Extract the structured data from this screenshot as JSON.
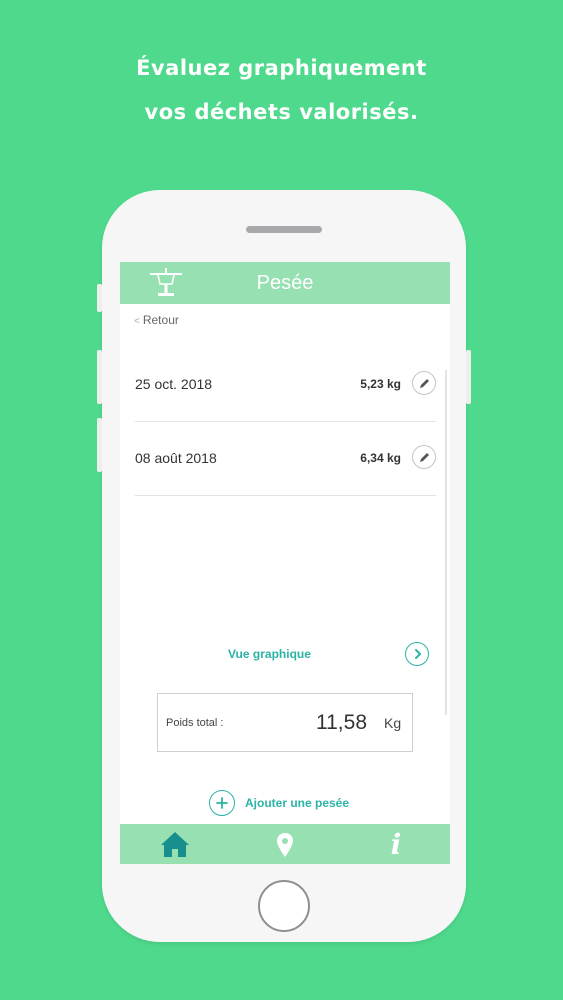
{
  "headline": {
    "line1": "Évaluez graphiquement",
    "line2": "vos déchets valorisés."
  },
  "app": {
    "title": "Pesée",
    "back_label": "Retour",
    "logo_icon": "scale-icon"
  },
  "weighings": [
    {
      "date": "25 oct. 2018",
      "weight": "5,23 kg"
    },
    {
      "date": "08 août 2018",
      "weight": "6,34 kg"
    }
  ],
  "graph_link_label": "Vue graphique",
  "total": {
    "label": "Poids total :",
    "value": "11,58",
    "unit": "Kg"
  },
  "add_label": "Ajouter une pesée",
  "tabs": [
    {
      "icon": "home-icon",
      "active": true
    },
    {
      "icon": "map-pin-icon",
      "active": false
    },
    {
      "icon": "info-icon",
      "active": false
    }
  ],
  "colors": {
    "background": "#4fd98c",
    "header": "#96e0b2",
    "accent": "#2cb3a6",
    "active_tab": "#17908d"
  }
}
